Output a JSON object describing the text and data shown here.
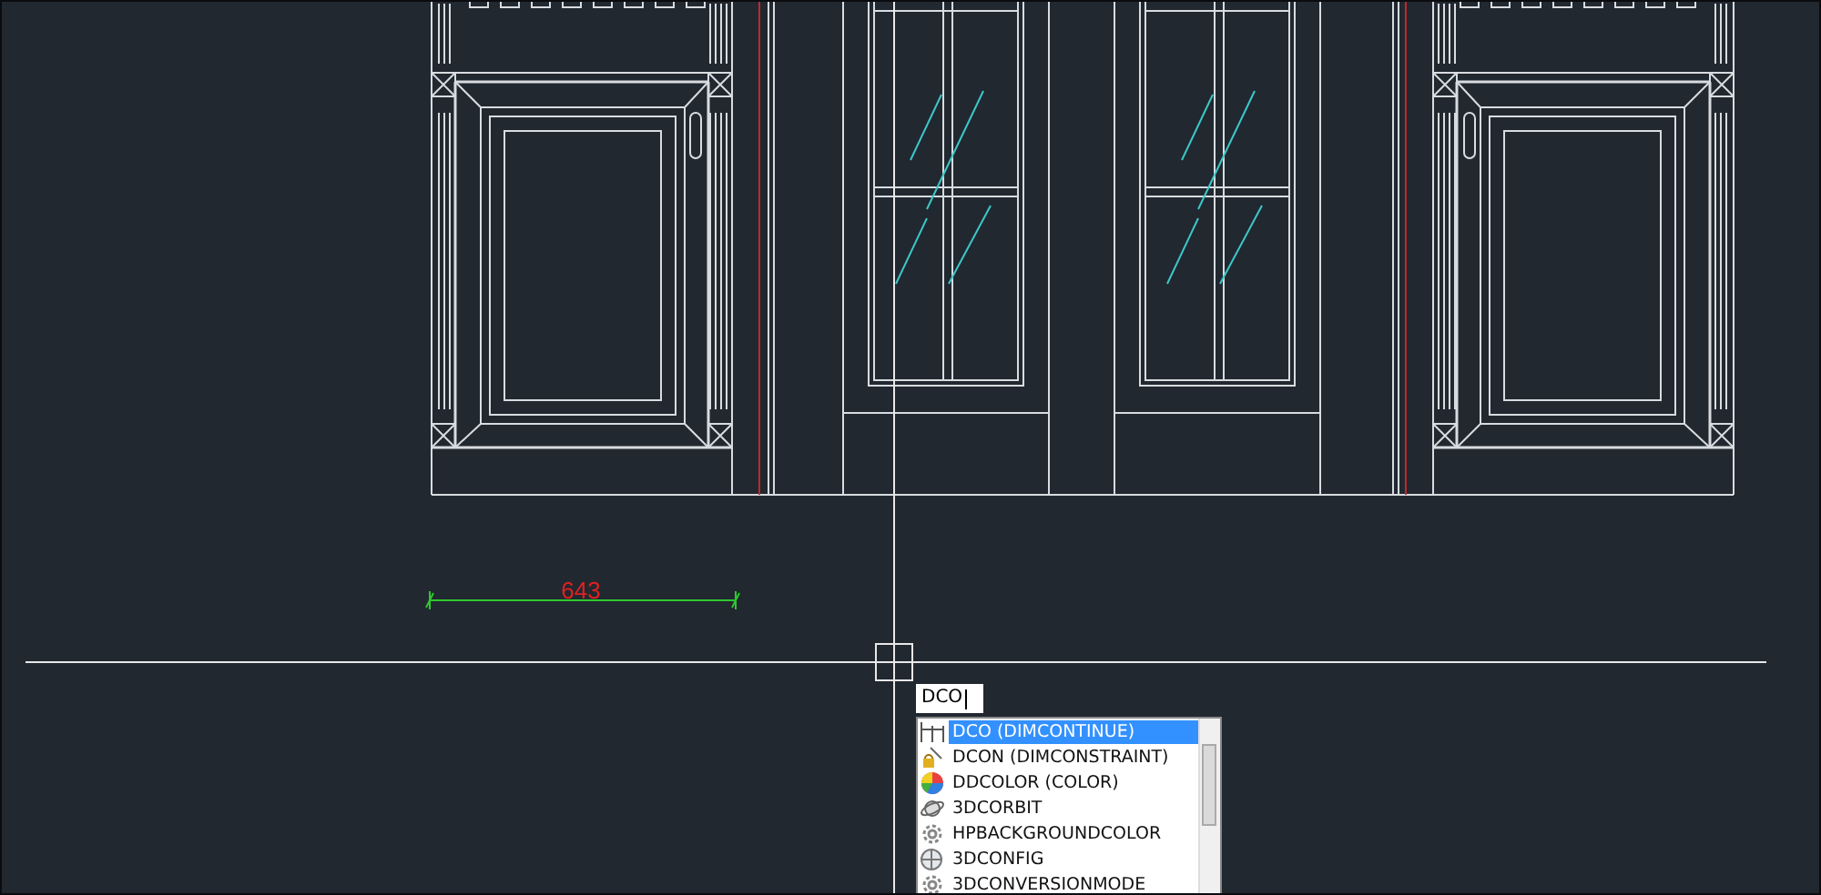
{
  "dimension": {
    "value": "643"
  },
  "command_line": {
    "value": "DCO"
  },
  "suggestions": [
    {
      "label": "DCO (DIMCONTINUE)",
      "kind": "dimension",
      "selected": true
    },
    {
      "label": "DCON (DIMCONSTRAINT)",
      "kind": "constraint",
      "selected": false
    },
    {
      "label": "DDCOLOR (COLOR)",
      "kind": "color",
      "selected": false
    },
    {
      "label": "3DCORBIT",
      "kind": "orbit",
      "selected": false
    },
    {
      "label": "HPBACKGROUNDCOLOR",
      "kind": "gear",
      "selected": false
    },
    {
      "label": "3DCONFIG",
      "kind": "config",
      "selected": false
    },
    {
      "label": "3DCONVERSIONMODE",
      "kind": "gear",
      "selected": false
    }
  ]
}
